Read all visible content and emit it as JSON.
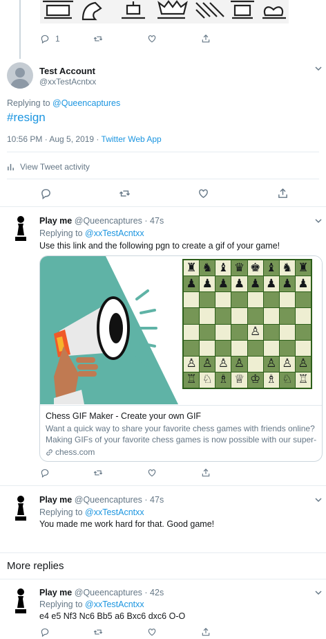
{
  "top_tweet": {
    "reply_count": "1"
  },
  "main_tweet": {
    "name": "Test Account",
    "handle": "@xxTestAcntxx",
    "replying_label": "Replying to",
    "replying_to": "@Queencaptures",
    "text": "#resign",
    "timestamp": "10:56 PM · Aug 5, 2019 · ",
    "source": "Twitter Web App",
    "activity": "View Tweet activity"
  },
  "replies": [
    {
      "name": "Play me",
      "handle": "@Queencaptures",
      "time": "· 47s",
      "replying_label": "Replying to",
      "replying_to": "@xxTestAcntxx",
      "text": "Use this link and the following pgn to create a gif of your game!"
    },
    {
      "name": "Play me",
      "handle": "@Queencaptures",
      "time": "· 47s",
      "replying_label": "Replying to",
      "replying_to": "@xxTestAcntxx",
      "text": "You made me work hard for that. Good game!"
    },
    {
      "name": "Play me",
      "handle": "@Queencaptures",
      "time": "· 42s",
      "replying_label": "Replying to",
      "replying_to": "@xxTestAcntxx",
      "text": "e4 e5 Nf3 Nc6 Bb5 a6 Bxc6 dxc6 O-O"
    }
  ],
  "card": {
    "title": "Chess GIF Maker - Create your own GIF",
    "description_line1": "Want a quick way to share your favorite chess games with friends online?",
    "description_line2": "Making GIFs of your favorite chess games is now possible with our super-...",
    "domain": "chess.com"
  },
  "more_replies": "More replies",
  "colors": {
    "link": "#1b95e0",
    "muted": "#657786",
    "divider": "#e6ecf0",
    "board_light": "#eeeed2",
    "board_dark": "#769656",
    "card_teal": "#5fb3a6"
  },
  "board_rows": [
    [
      "♜",
      "♞",
      "♝",
      "♛",
      "♚",
      "♝",
      "♞",
      "♜"
    ],
    [
      "♟",
      "♟",
      "♟",
      "♟",
      "♟",
      "♟",
      "♟",
      "♟"
    ],
    [
      "",
      "",
      "",
      "",
      "",
      "",
      "",
      ""
    ],
    [
      "",
      "",
      "",
      "",
      "",
      "",
      "",
      ""
    ],
    [
      "",
      "",
      "",
      "",
      "♙",
      "",
      "",
      ""
    ],
    [
      "",
      "",
      "",
      "",
      "",
      "",
      "",
      ""
    ],
    [
      "♙",
      "♙",
      "♙",
      "♙",
      "",
      "♙",
      "♙",
      "♙"
    ],
    [
      "♖",
      "♘",
      "♗",
      "♕",
      "♔",
      "♗",
      "♘",
      "♖"
    ]
  ]
}
